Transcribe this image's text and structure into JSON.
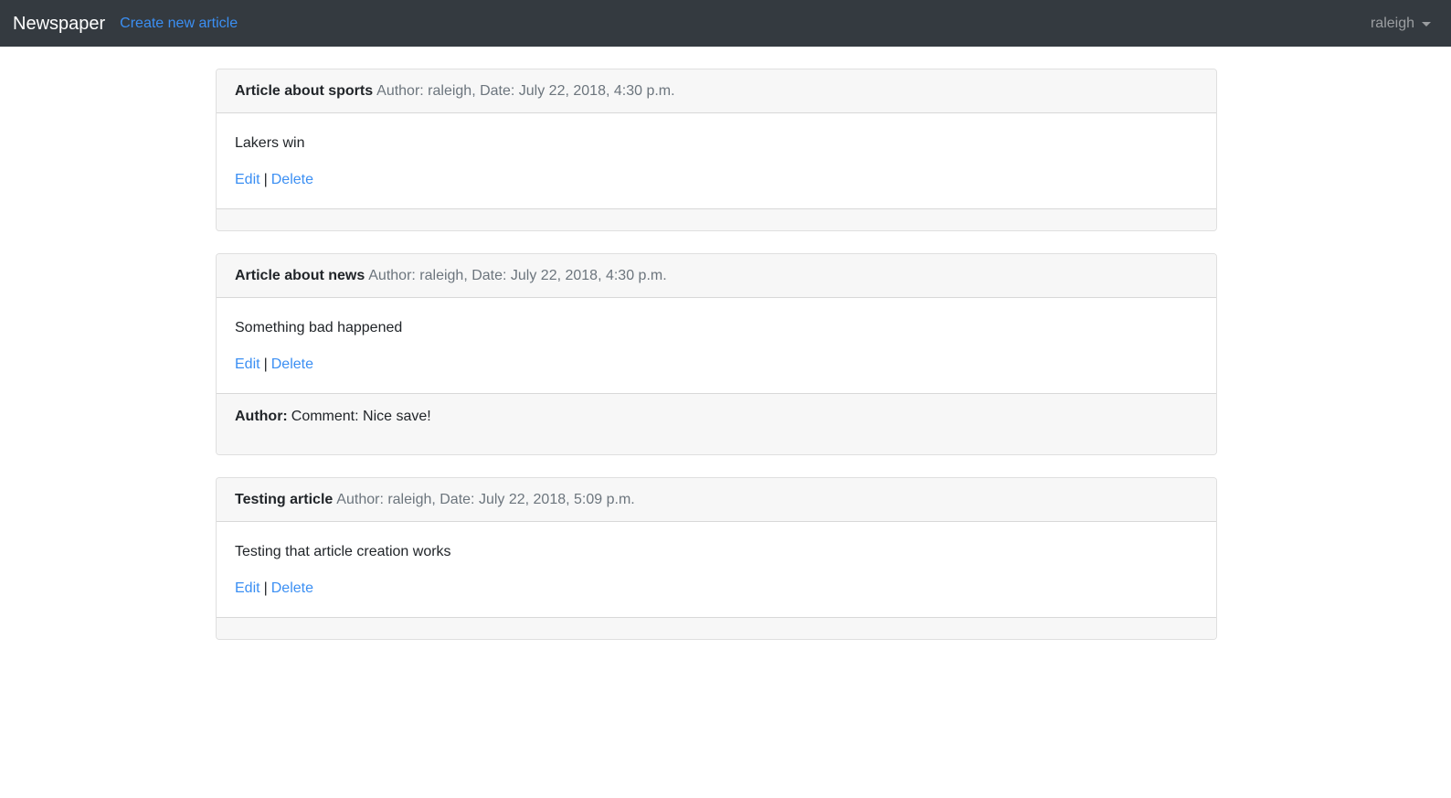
{
  "navbar": {
    "brand": "Newspaper",
    "create_link": "Create new article",
    "user": "raleigh",
    "caret_icon": "caret-down-icon",
    "colors": {
      "background": "#343a40",
      "link": "#3b8ff3"
    }
  },
  "articles": [
    {
      "title": "Article about sports",
      "meta": "Author: raleigh, Date: July 22, 2018, 4:30 p.m.",
      "body": "Lakers win",
      "edit_label": "Edit",
      "separator": "|",
      "delete_label": "Delete"
    },
    {
      "title": "Article about news",
      "meta": "Author: raleigh, Date: July 22, 2018, 4:30 p.m.",
      "body": "Something bad happened",
      "edit_label": "Edit",
      "separator": "|",
      "delete_label": "Delete",
      "comment": {
        "label": "Author:",
        "text": "Comment: Nice save!"
      }
    },
    {
      "title": "Testing article",
      "meta": "Author: raleigh, Date: July 22, 2018, 5:09 p.m.",
      "body": "Testing that article creation works",
      "edit_label": "Edit",
      "separator": "|",
      "delete_label": "Delete"
    }
  ]
}
